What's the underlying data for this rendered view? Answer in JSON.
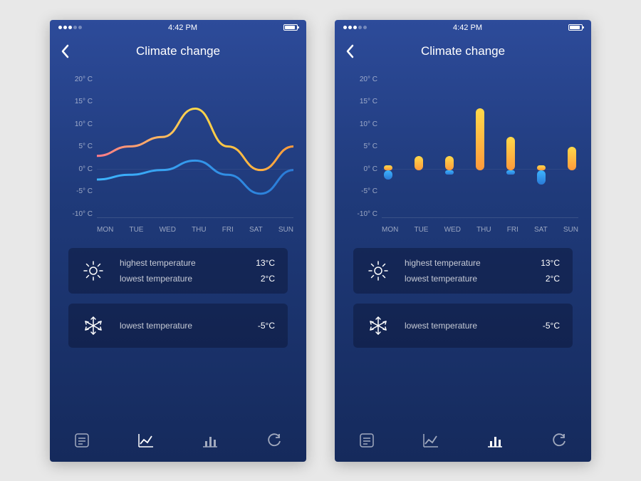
{
  "statusbar": {
    "time": "4:42 PM"
  },
  "header": {
    "title": "Climate change"
  },
  "y_ticks": [
    "20° C",
    "15° C",
    "10° C",
    "5° C",
    "0° C",
    "-5° C",
    "-10° C"
  ],
  "x_ticks": [
    "MON",
    "TUE",
    "WED",
    "THU",
    "FRI",
    "SAT",
    "SUN"
  ],
  "cards": {
    "sun": {
      "high_label": "highest temperature",
      "high_value": "13°C",
      "low_label": "lowest temperature",
      "low_value": "2°C"
    },
    "snow": {
      "low_label": "lowest temperature",
      "low_value": "-5°C"
    }
  },
  "chart_data": [
    {
      "type": "line",
      "title": "Climate change",
      "xlabel": "",
      "ylabel": "°C",
      "ylim": [
        -10,
        20
      ],
      "categories": [
        "MON",
        "TUE",
        "WED",
        "THU",
        "FRI",
        "SAT",
        "SUN"
      ],
      "series": [
        {
          "name": "high",
          "values": [
            3,
            5,
            7,
            13,
            5,
            0,
            5
          ],
          "color": "#ffb347"
        },
        {
          "name": "low",
          "values": [
            -2,
            -1,
            0,
            2,
            -1,
            -5,
            0
          ],
          "color": "#3db5ff"
        }
      ]
    },
    {
      "type": "bar",
      "title": "Climate change",
      "xlabel": "",
      "ylabel": "°C",
      "ylim": [
        -10,
        20
      ],
      "categories": [
        "MON",
        "TUE",
        "WED",
        "THU",
        "FRI",
        "SAT",
        "SUN"
      ],
      "series": [
        {
          "name": "high",
          "values": [
            1,
            3,
            3,
            13,
            7,
            1,
            5
          ],
          "color": "#ffb347"
        },
        {
          "name": "low",
          "values": [
            -2,
            0,
            -1,
            0,
            -1,
            -3,
            0
          ],
          "color": "#3db5ff"
        }
      ]
    }
  ]
}
